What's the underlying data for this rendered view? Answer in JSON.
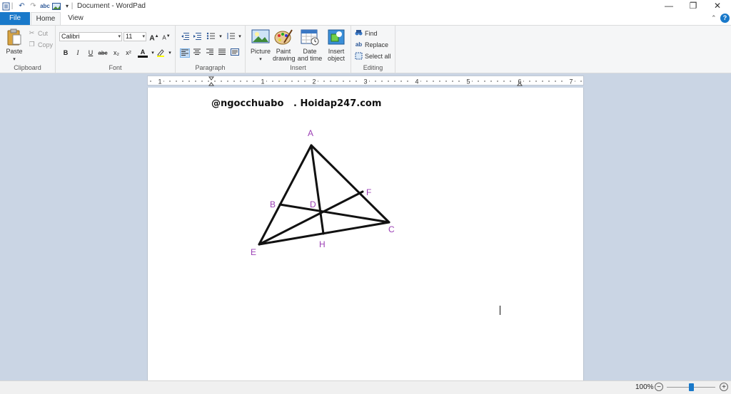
{
  "app": {
    "title": "Document - WordPad"
  },
  "tabs": {
    "file": "File",
    "home": "Home",
    "view": "View"
  },
  "clipboard": {
    "paste": "Paste",
    "cut": "Cut",
    "copy": "Copy",
    "label": "Clipboard"
  },
  "font": {
    "family": "Calibri",
    "size": "11",
    "label": "Font",
    "bold": "B",
    "italic": "I",
    "underline": "U",
    "strike": "abc",
    "subscript": "x₂",
    "superscript": "x²",
    "color_glyph": "A",
    "grow": "A",
    "shrink": "A"
  },
  "paragraph": {
    "label": "Paragraph"
  },
  "insert": {
    "picture": "Picture",
    "paint": "Paint drawing",
    "datetime": "Date and time",
    "object": "Insert object",
    "label": "Insert"
  },
  "editing": {
    "find": "Find",
    "replace": "Replace",
    "select_all": "Select all",
    "label": "Editing"
  },
  "ruler": {
    "ticks": [
      "1",
      "1",
      "2",
      "3",
      "4",
      "5",
      "6",
      "7"
    ]
  },
  "document": {
    "header_text": "@ngocchuabo   . Hoidap247.com",
    "points": {
      "A": "A",
      "B": "B",
      "C": "C",
      "D": "D",
      "E": "E",
      "F": "F",
      "H": "H"
    }
  },
  "status": {
    "zoom": "100%"
  },
  "colors": {
    "file_tab": "#1979ca",
    "workspace": "#cad5e4",
    "label_purple": "#9b3fb5"
  }
}
